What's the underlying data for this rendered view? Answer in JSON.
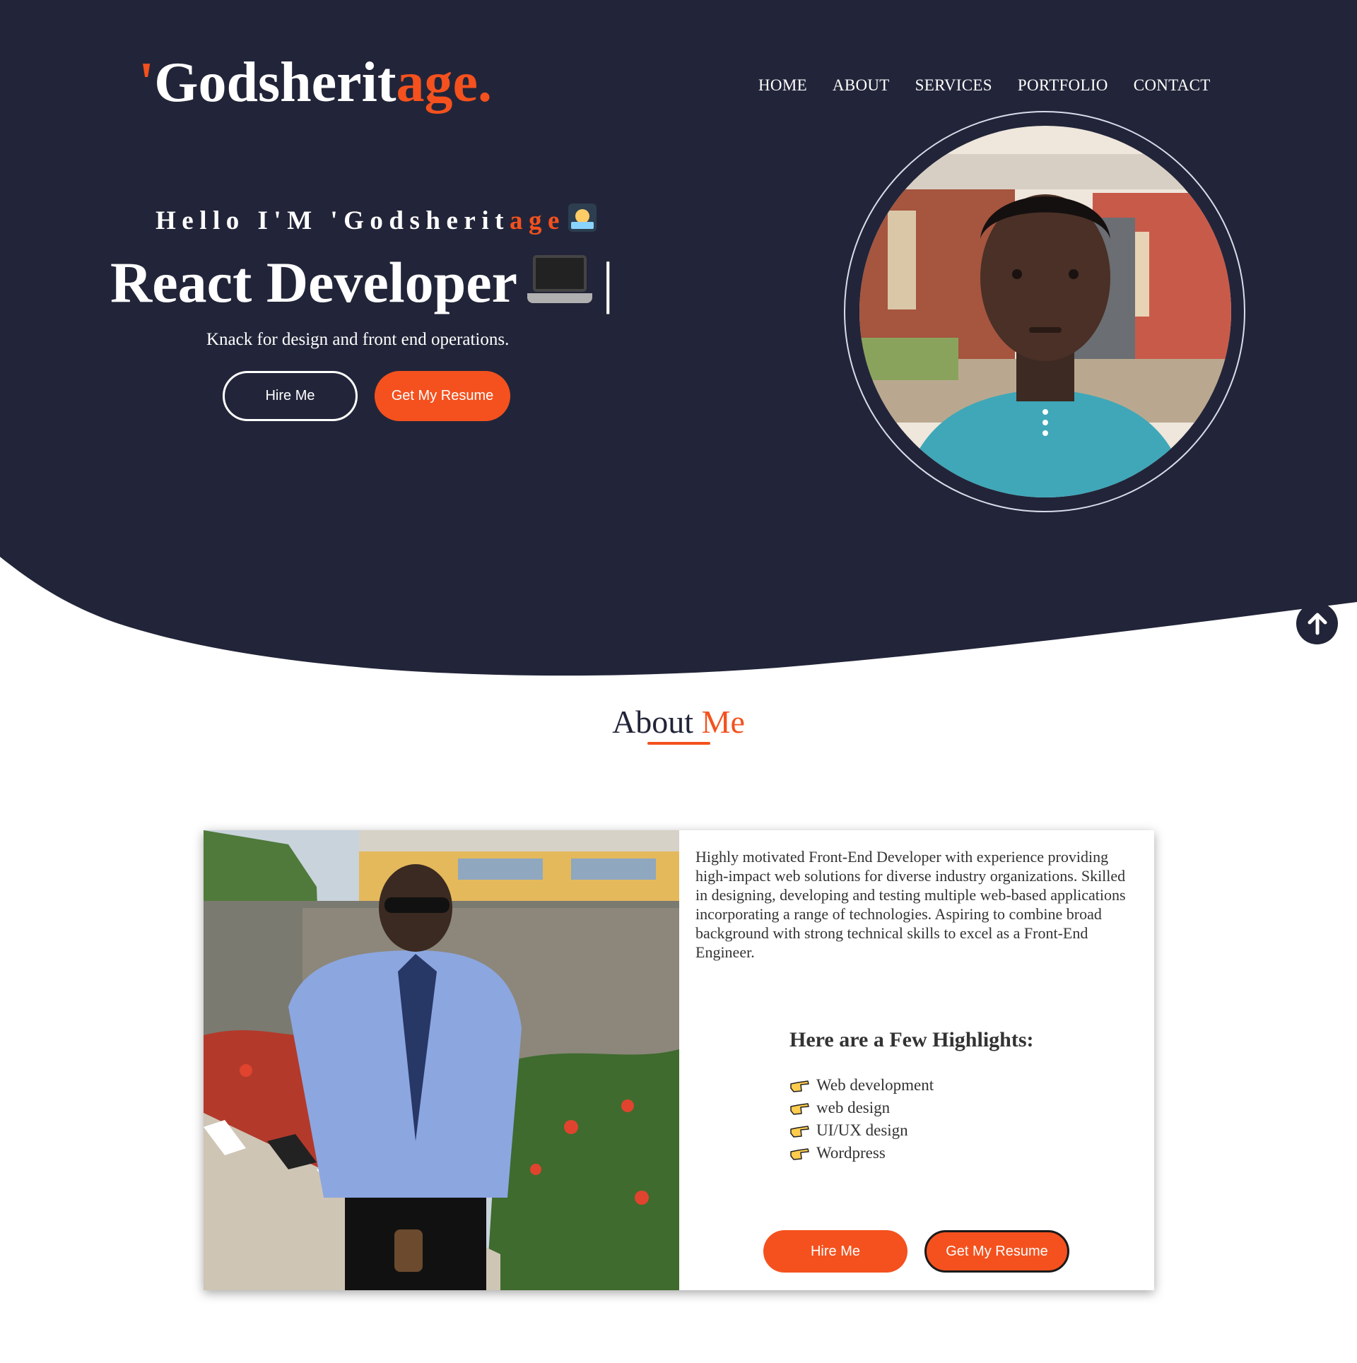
{
  "colors": {
    "navy": "#222539",
    "accent": "#f4511e",
    "white": "#ffffff",
    "text": "#333333"
  },
  "brand": {
    "apostrophe": "'",
    "main": "Godsherit",
    "accent": "age."
  },
  "nav": {
    "items": [
      {
        "label": "HOME"
      },
      {
        "label": "ABOUT"
      },
      {
        "label": "SERVICES"
      },
      {
        "label": "PORTFOLIO"
      },
      {
        "label": "CONTACT"
      }
    ]
  },
  "hero": {
    "greeting_prefix": "Hello I'M ",
    "greeting_name_main": "'Godsherit",
    "greeting_name_accent": "age",
    "greeting_emoji": "technologist-emoji",
    "role": "React Developer",
    "role_emoji": "laptop-emoji",
    "cursor": "|",
    "tagline": "Knack for design and front end operations.",
    "hire_label": "Hire Me",
    "resume_label": "Get My Resume"
  },
  "scroll_top": {
    "icon": "arrow-up-icon"
  },
  "about": {
    "title_main": "About ",
    "title_accent": "Me",
    "bio": "Highly motivated Front-End Developer with experience providing high-impact web solutions for diverse industry organizations. Skilled in designing, developing and testing multiple web-based applications incorporating a range of technologies. Aspiring to combine broad background with strong technical skills to excel as a Front-End Engineer.",
    "highlights_title": "Here are a Few Highlights:",
    "highlights": [
      {
        "icon": "pointing-hand-icon",
        "label": "Web development"
      },
      {
        "icon": "pointing-hand-icon",
        "label": "web design"
      },
      {
        "icon": "pointing-hand-icon",
        "label": "UI/UX design"
      },
      {
        "icon": "pointing-hand-icon",
        "label": "Wordpress"
      }
    ],
    "hire_label": "Hire Me",
    "resume_label": "Get My Resume"
  }
}
